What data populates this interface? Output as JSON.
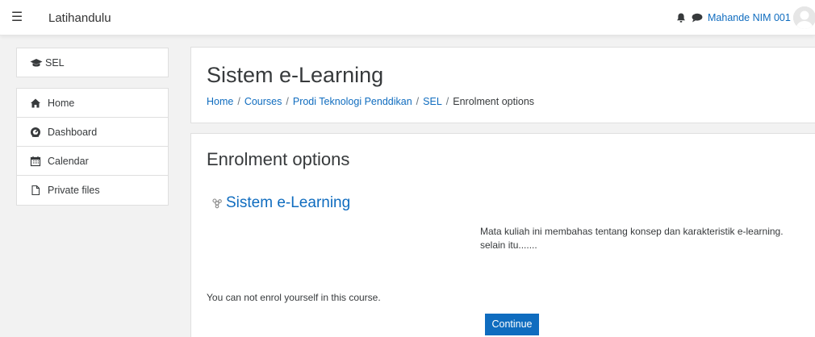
{
  "header": {
    "site_name": "Latihandulu",
    "menu_icon": "hamburger-menu-icon",
    "notification_icon": "bell-icon",
    "messages_icon": "chat-bubble-icon",
    "user_name": "Mahande NIM 001"
  },
  "sidebar": {
    "course_block": {
      "icon": "graduation-cap-icon",
      "label": "SEL"
    },
    "items": [
      {
        "icon": "home-icon",
        "label": "Home"
      },
      {
        "icon": "dashboard-icon",
        "label": "Dashboard"
      },
      {
        "icon": "calendar-icon",
        "label": "Calendar"
      },
      {
        "icon": "file-icon",
        "label": "Private files"
      }
    ]
  },
  "page": {
    "title": "Sistem e-Learning",
    "breadcrumbs": [
      "Home",
      "Courses",
      "Prodi Teknologi Penddikan",
      "SEL",
      "Enrolment options"
    ],
    "breadcrumb_separator": "/"
  },
  "main": {
    "section_title": "Enrolment options",
    "course_name": "Sistem e-Learning",
    "course_summary": "Mata kuliah ini membahas tentang konsep dan karakteristik e-learning. selain itu.......",
    "notice": "You can not enrol yourself in this course.",
    "continue_label": "Continue"
  },
  "colors": {
    "link": "#0f6cbf",
    "button": "#0f6cbf",
    "page_bg": "#f2f2f2",
    "text": "#373a3c"
  }
}
